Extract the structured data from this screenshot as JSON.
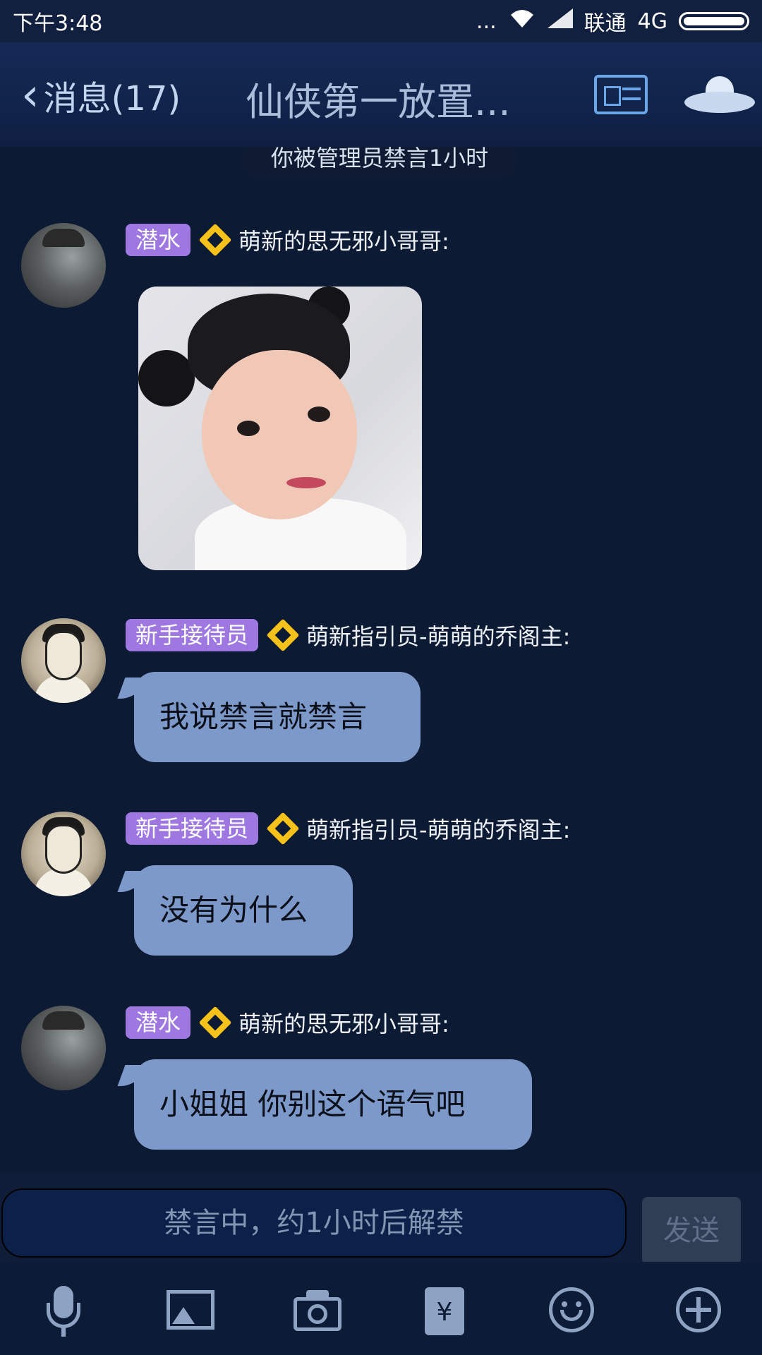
{
  "status_bar": {
    "time": "下午3:48",
    "dots": "...",
    "carrier": "联通",
    "network": "4G",
    "icons": [
      "wifi-icon",
      "signal-icon",
      "battery-icon"
    ]
  },
  "header": {
    "back_label": "消息(17)",
    "title": "仙侠第一放置...",
    "right_icons": [
      "profile-card-icon",
      "ufo-icon"
    ]
  },
  "chat": {
    "notice": "你被管理员禁言1小时",
    "messages": [
      {
        "badge": "潜水",
        "nick": "萌新的思无邪小哥哥:",
        "type": "image",
        "avatar": "gray-avatar"
      },
      {
        "badge": "新手接待员",
        "nick": "萌新指引员-萌萌的乔阁主:",
        "type": "text",
        "text": "我说禁言就禁言",
        "avatar": "sketch-avatar"
      },
      {
        "badge": "新手接待员",
        "nick": "萌新指引员-萌萌的乔阁主:",
        "type": "text",
        "text": "没有为什么",
        "avatar": "sketch-avatar"
      },
      {
        "badge": "潜水",
        "nick": "萌新的思无邪小哥哥:",
        "type": "text",
        "text": "小姐姐 你别这个语气吧",
        "avatar": "gray-avatar"
      }
    ]
  },
  "input": {
    "placeholder": "禁言中，约1小时后解禁",
    "send_label": "发送"
  },
  "toolbar": {
    "icons": [
      "mic-icon",
      "image-icon",
      "camera-icon",
      "red-envelope-icon",
      "emoji-icon",
      "plus-icon"
    ],
    "red_envelope_symbol": "¥"
  },
  "colors": {
    "background": "#0c1a33",
    "bubble": "#7c99c9",
    "badge": "#9e77e1",
    "star": "#f4c21a"
  }
}
